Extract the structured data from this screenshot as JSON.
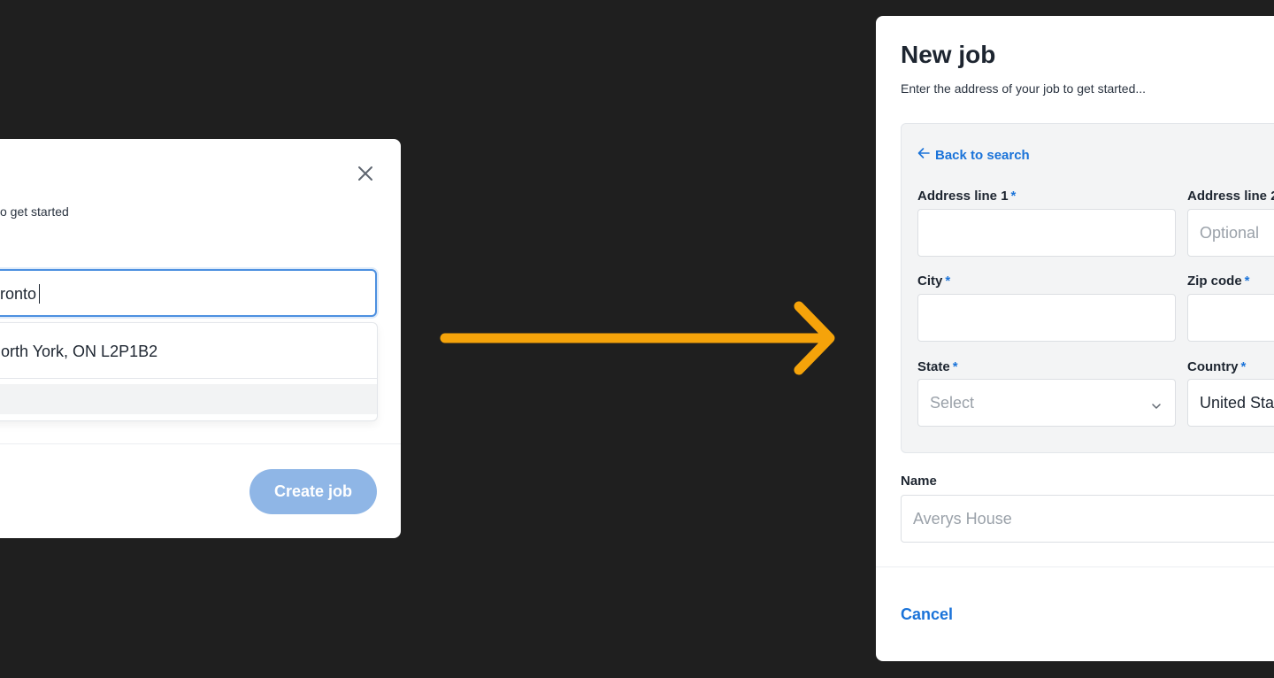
{
  "left_modal": {
    "subtitle_visible": "o get started",
    "search_value_visible": "ronto",
    "suggestion_visible": "orth York, ON L2P1B2",
    "create_button_label": "Create job"
  },
  "right_modal": {
    "title": "New job",
    "subtitle": "Enter the address of your job to get started...",
    "back_link_label": "Back to search",
    "address_line1_label": "Address line 1",
    "address_line2_label": "Address line 2",
    "address_line2_placeholder": "Optional",
    "city_label": "City",
    "zip_label": "Zip code",
    "state_label": "State",
    "state_placeholder": "Select",
    "country_label": "Country",
    "country_value_visible": "United Sta",
    "required_marker": "*",
    "name_label": "Name",
    "name_placeholder": "Averys House",
    "cancel_label": "Cancel"
  },
  "icons": {
    "close": "close-icon",
    "back": "arrow-left-icon",
    "chevron": "chevron-down-icon",
    "flow": "arrow-right-icon"
  },
  "colors": {
    "background": "#1f1f1f",
    "accent": "#1a73d9",
    "arrow": "#f5a30a",
    "disabled_button": "#8fb6e6",
    "focus_border": "#4d90e0"
  }
}
